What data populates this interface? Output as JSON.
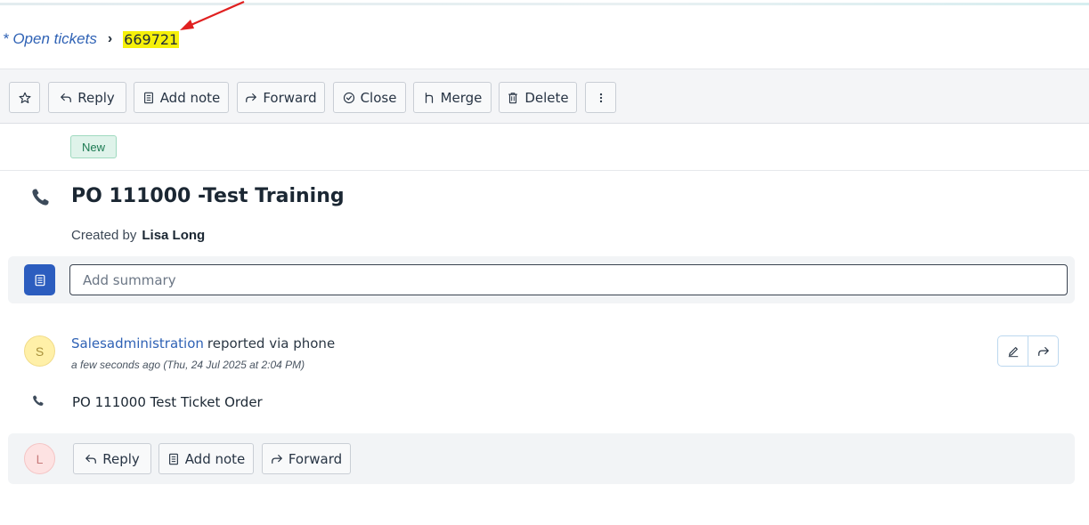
{
  "breadcrumb": {
    "parent": "* Open tickets",
    "separator": "›",
    "current": "669721"
  },
  "toolbar": {
    "reply": "Reply",
    "add_note": "Add note",
    "forward": "Forward",
    "close": "Close",
    "merge": "Merge",
    "delete": "Delete"
  },
  "ticket": {
    "status": "New",
    "title": "PO 111000 -Test Training",
    "created_by_label": "Created by",
    "created_by_name": "Lisa Long",
    "summary_placeholder": "Add summary"
  },
  "article": {
    "avatar_initial": "S",
    "author": "Salesadministration",
    "channel_text": "reported via phone",
    "timestamp": "a few seconds ago (Thu, 24 Jul 2025 at 2:04 PM)",
    "body": "PO 111000 Test Ticket Order"
  },
  "reply_bar": {
    "avatar_initial": "L",
    "reply": "Reply",
    "add_note": "Add note",
    "forward": "Forward"
  },
  "colors": {
    "link": "#2f62b5",
    "highlight": "#f5f00a",
    "status_bg": "#dff3ea",
    "summary_icon": "#2c5dbf",
    "arrow": "#e02020"
  }
}
